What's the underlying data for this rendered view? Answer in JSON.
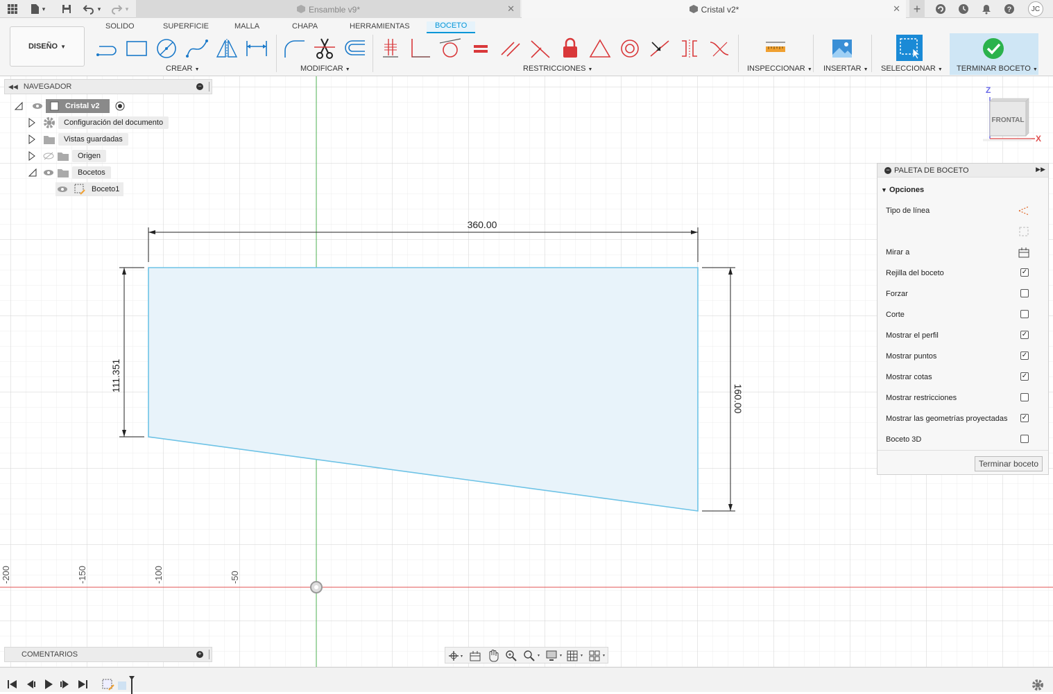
{
  "tabs": {
    "inactive": "Ensamble v9*",
    "active": "Cristal v2*"
  },
  "user_initials": "JC",
  "ribbon": {
    "workspace": "DISEÑO",
    "tabs": [
      "SOLIDO",
      "SUPERFICIE",
      "MALLA",
      "CHAPA",
      "HERRAMIENTAS",
      "BOCETO"
    ],
    "groups": {
      "crear": "CREAR",
      "modificar": "MODIFICAR",
      "restricciones": "RESTRICCIONES",
      "inspeccionar": "INSPECCIONAR",
      "insertar": "INSERTAR",
      "seleccionar": "SELECCIONAR",
      "terminar": "TERMINAR BOCETO"
    }
  },
  "browser": {
    "title": "NAVEGADOR",
    "root": "Cristal v2",
    "items": [
      "Configuración del documento",
      "Vistas guardadas",
      "Origen",
      "Bocetos"
    ],
    "sketch": "Boceto1"
  },
  "comments": "COMENTARIOS",
  "viewcube": {
    "face": "FRONTAL",
    "z": "Z",
    "x": "X"
  },
  "dimensions": {
    "top": "360.00",
    "left": "111.351",
    "right": "160.00"
  },
  "axis_ticks": [
    "-200",
    "-150",
    "-100",
    "-50"
  ],
  "palette": {
    "title": "PALETA DE BOCETO",
    "section": "Opciones",
    "rows": [
      {
        "label": "Tipo de línea",
        "checked": null
      },
      {
        "label": "Mirar a",
        "checked": null
      },
      {
        "label": "Rejilla del boceto",
        "checked": true
      },
      {
        "label": "Forzar",
        "checked": false
      },
      {
        "label": "Corte",
        "checked": false
      },
      {
        "label": "Mostrar el perfil",
        "checked": true
      },
      {
        "label": "Mostrar puntos",
        "checked": true
      },
      {
        "label": "Mostrar cotas",
        "checked": true
      },
      {
        "label": "Mostrar restricciones",
        "checked": false
      },
      {
        "label": "Mostrar las geometrías proyectadas",
        "checked": true
      },
      {
        "label": "Boceto 3D",
        "checked": false
      }
    ],
    "finish_button": "Terminar boceto"
  },
  "colors": {
    "accent": "#0696d7",
    "profile_fill": "#e8f3fa",
    "profile_line": "#6ec3e6",
    "x_axis": "#e05050",
    "y_axis": "#4caf50",
    "constraint_red": "#d9383a",
    "finish_green": "#2bb24c"
  }
}
